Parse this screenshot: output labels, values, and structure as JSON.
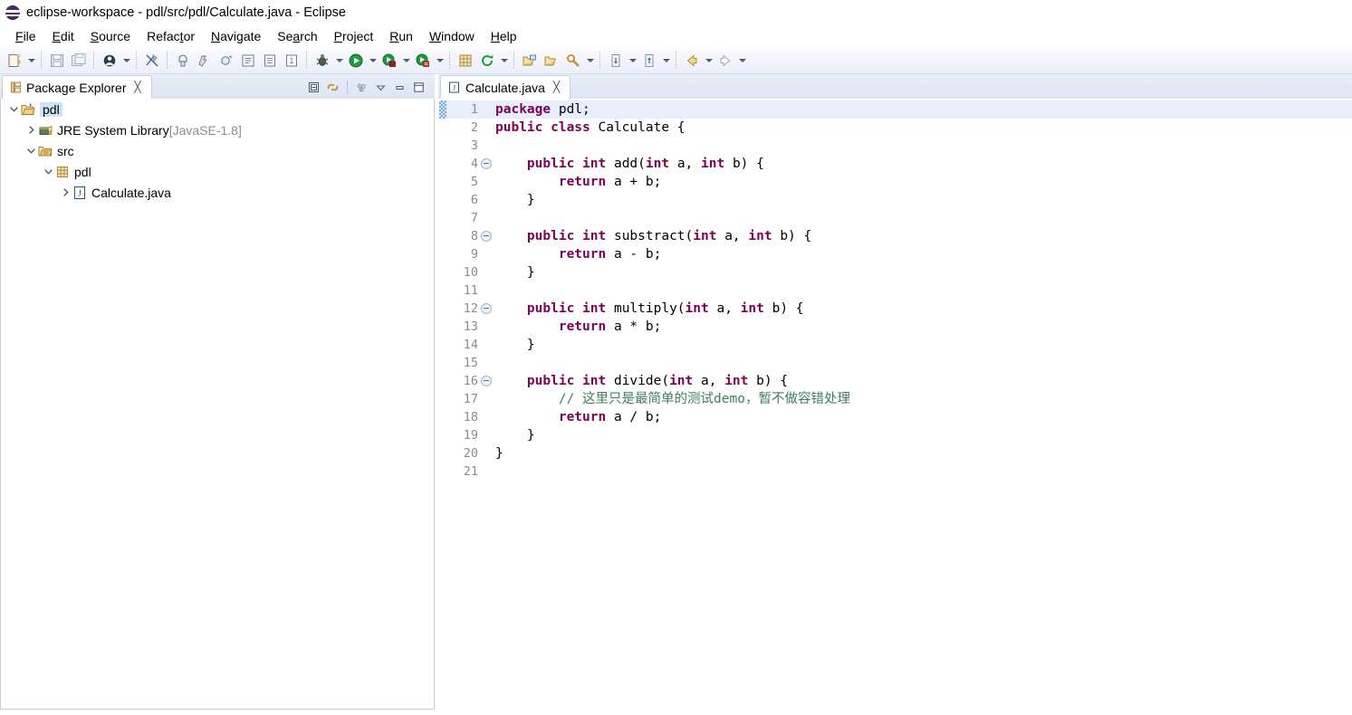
{
  "window": {
    "title": "eclipse-workspace - pdl/src/pdl/Calculate.java - Eclipse",
    "app_icon": "eclipse-icon"
  },
  "menubar": {
    "items": [
      {
        "label": "File",
        "mnemonic": "F"
      },
      {
        "label": "Edit",
        "mnemonic": "E"
      },
      {
        "label": "Source",
        "mnemonic": "S"
      },
      {
        "label": "Refactor",
        "mnemonic": "t"
      },
      {
        "label": "Navigate",
        "mnemonic": "N"
      },
      {
        "label": "Search",
        "mnemonic": "a"
      },
      {
        "label": "Project",
        "mnemonic": "P"
      },
      {
        "label": "Run",
        "mnemonic": "R"
      },
      {
        "label": "Window",
        "mnemonic": "W"
      },
      {
        "label": "Help",
        "mnemonic": "H"
      }
    ]
  },
  "toolbar": {
    "groups": [
      {
        "buttons": [
          {
            "icon": "new-wizard-icon",
            "dropdown": true
          }
        ]
      },
      {
        "buttons": [
          {
            "icon": "save-icon",
            "dropdown": false
          },
          {
            "icon": "save-all-icon",
            "dropdown": false
          }
        ]
      },
      {
        "buttons": [
          {
            "icon": "print-icon",
            "dropdown": true
          }
        ]
      },
      {
        "buttons": [
          {
            "icon": "toggle-mark-occurrences-icon",
            "dropdown": false
          }
        ]
      },
      {
        "buttons": [
          {
            "icon": "new-java-project-icon",
            "dropdown": false
          },
          {
            "icon": "new-package-icon",
            "dropdown": false
          },
          {
            "icon": "new-class-icon",
            "dropdown": false
          },
          {
            "icon": "new-interface-icon",
            "dropdown": false
          },
          {
            "icon": "new-enum-icon",
            "dropdown": false
          },
          {
            "icon": "new-annotation-icon",
            "dropdown": false
          }
        ]
      },
      {
        "buttons": [
          {
            "icon": "debug-icon",
            "dropdown": true
          },
          {
            "icon": "run-icon",
            "dropdown": true
          },
          {
            "icon": "coverage-icon",
            "dropdown": true
          },
          {
            "icon": "external-tools-icon",
            "dropdown": true
          }
        ]
      },
      {
        "buttons": [
          {
            "icon": "new-java-element-icon",
            "dropdown": false
          },
          {
            "icon": "refresh-icon",
            "dropdown": true
          }
        ]
      },
      {
        "buttons": [
          {
            "icon": "open-type-icon",
            "dropdown": false
          },
          {
            "icon": "open-task-icon",
            "dropdown": false
          },
          {
            "icon": "search-icon",
            "dropdown": true
          }
        ]
      },
      {
        "buttons": [
          {
            "icon": "next-annotation-icon",
            "dropdown": true
          },
          {
            "icon": "previous-annotation-icon",
            "dropdown": true
          }
        ]
      },
      {
        "buttons": [
          {
            "icon": "back-icon",
            "dropdown": true
          },
          {
            "icon": "forward-icon",
            "dropdown": true
          }
        ]
      }
    ]
  },
  "package_explorer": {
    "tab": {
      "title": "Package Explorer",
      "icon": "package-explorer-icon",
      "close": "╳"
    },
    "view_toolbar": [
      {
        "icon": "collapse-all-icon"
      },
      {
        "icon": "link-with-editor-icon"
      },
      {
        "icon": "view-menu-dots-icon"
      },
      {
        "icon": "view-menu-chevron-icon"
      },
      {
        "icon": "minimize-icon"
      },
      {
        "icon": "maximize-icon"
      }
    ],
    "tree": [
      {
        "label": "pdl",
        "suffix": "",
        "indent": 0,
        "twisty": "down",
        "icon": "java-project-icon",
        "selected": true
      },
      {
        "label": "JRE System Library",
        "suffix": " [JavaSE-1.8]",
        "indent": 1,
        "twisty": "right",
        "icon": "library-icon",
        "selected": false
      },
      {
        "label": "src",
        "suffix": "",
        "indent": 1,
        "twisty": "down",
        "icon": "source-folder-icon",
        "selected": false
      },
      {
        "label": "pdl",
        "suffix": "",
        "indent": 2,
        "twisty": "down",
        "icon": "package-icon",
        "selected": false
      },
      {
        "label": "Calculate.java",
        "suffix": "",
        "indent": 3,
        "twisty": "right",
        "icon": "java-file-icon",
        "selected": false
      }
    ]
  },
  "editor": {
    "tab": {
      "title": "Calculate.java",
      "icon": "java-file-icon",
      "close": "╳"
    },
    "current_line": 1,
    "change_marker_line": 1,
    "fold_lines": [
      4,
      8,
      12,
      16
    ],
    "lines": [
      {
        "n": 1,
        "tokens": [
          {
            "t": "kw",
            "v": "package"
          },
          {
            "t": "plain",
            "v": " pdl;"
          }
        ]
      },
      {
        "n": 2,
        "tokens": [
          {
            "t": "kw",
            "v": "public class"
          },
          {
            "t": "plain",
            "v": " Calculate {"
          }
        ]
      },
      {
        "n": 3,
        "tokens": []
      },
      {
        "n": 4,
        "tokens": [
          {
            "t": "plain",
            "v": "\t"
          },
          {
            "t": "kw",
            "v": "public int"
          },
          {
            "t": "plain",
            "v": " add("
          },
          {
            "t": "kw",
            "v": "int"
          },
          {
            "t": "plain",
            "v": " a, "
          },
          {
            "t": "kw",
            "v": "int"
          },
          {
            "t": "plain",
            "v": " b) {"
          }
        ]
      },
      {
        "n": 5,
        "tokens": [
          {
            "t": "plain",
            "v": "\t\t"
          },
          {
            "t": "kw",
            "v": "return"
          },
          {
            "t": "plain",
            "v": " a + b;"
          }
        ]
      },
      {
        "n": 6,
        "tokens": [
          {
            "t": "plain",
            "v": "\t}"
          }
        ]
      },
      {
        "n": 7,
        "tokens": []
      },
      {
        "n": 8,
        "tokens": [
          {
            "t": "plain",
            "v": "\t"
          },
          {
            "t": "kw",
            "v": "public int"
          },
          {
            "t": "plain",
            "v": " substract("
          },
          {
            "t": "kw",
            "v": "int"
          },
          {
            "t": "plain",
            "v": " a, "
          },
          {
            "t": "kw",
            "v": "int"
          },
          {
            "t": "plain",
            "v": " b) {"
          }
        ]
      },
      {
        "n": 9,
        "tokens": [
          {
            "t": "plain",
            "v": "\t\t"
          },
          {
            "t": "kw",
            "v": "return"
          },
          {
            "t": "plain",
            "v": " a - b;"
          }
        ]
      },
      {
        "n": 10,
        "tokens": [
          {
            "t": "plain",
            "v": "\t}"
          }
        ]
      },
      {
        "n": 11,
        "tokens": []
      },
      {
        "n": 12,
        "tokens": [
          {
            "t": "plain",
            "v": "\t"
          },
          {
            "t": "kw",
            "v": "public int"
          },
          {
            "t": "plain",
            "v": " multiply("
          },
          {
            "t": "kw",
            "v": "int"
          },
          {
            "t": "plain",
            "v": " a, "
          },
          {
            "t": "kw",
            "v": "int"
          },
          {
            "t": "plain",
            "v": " b) {"
          }
        ]
      },
      {
        "n": 13,
        "tokens": [
          {
            "t": "plain",
            "v": "\t\t"
          },
          {
            "t": "kw",
            "v": "return"
          },
          {
            "t": "plain",
            "v": " a * b;"
          }
        ]
      },
      {
        "n": 14,
        "tokens": [
          {
            "t": "plain",
            "v": "\t}"
          }
        ]
      },
      {
        "n": 15,
        "tokens": []
      },
      {
        "n": 16,
        "tokens": [
          {
            "t": "plain",
            "v": "\t"
          },
          {
            "t": "kw",
            "v": "public int"
          },
          {
            "t": "plain",
            "v": " divide("
          },
          {
            "t": "kw",
            "v": "int"
          },
          {
            "t": "plain",
            "v": " a, "
          },
          {
            "t": "kw",
            "v": "int"
          },
          {
            "t": "plain",
            "v": " b) {"
          }
        ]
      },
      {
        "n": 17,
        "tokens": [
          {
            "t": "plain",
            "v": "\t\t"
          },
          {
            "t": "cmt",
            "v": "// 这里只是最简单的测试demo，暂不做容错处理"
          }
        ]
      },
      {
        "n": 18,
        "tokens": [
          {
            "t": "plain",
            "v": "\t\t"
          },
          {
            "t": "kw",
            "v": "return"
          },
          {
            "t": "plain",
            "v": " a / b;"
          }
        ]
      },
      {
        "n": 19,
        "tokens": [
          {
            "t": "plain",
            "v": "\t}"
          }
        ]
      },
      {
        "n": 20,
        "tokens": [
          {
            "t": "plain",
            "v": "}"
          }
        ]
      },
      {
        "n": 21,
        "tokens": []
      }
    ]
  },
  "colors": {
    "keyword": "#7F0055",
    "comment": "#3F7F5F",
    "plain": "#000000",
    "selection": "#CDE3F7",
    "current_line": "#E8EEFB",
    "panel_border": "#C3CEDE",
    "tab_gradient_top": "#E8EEF8",
    "tab_gradient_bottom": "#DDE6F4",
    "dim_text": "#8D8D8D"
  }
}
